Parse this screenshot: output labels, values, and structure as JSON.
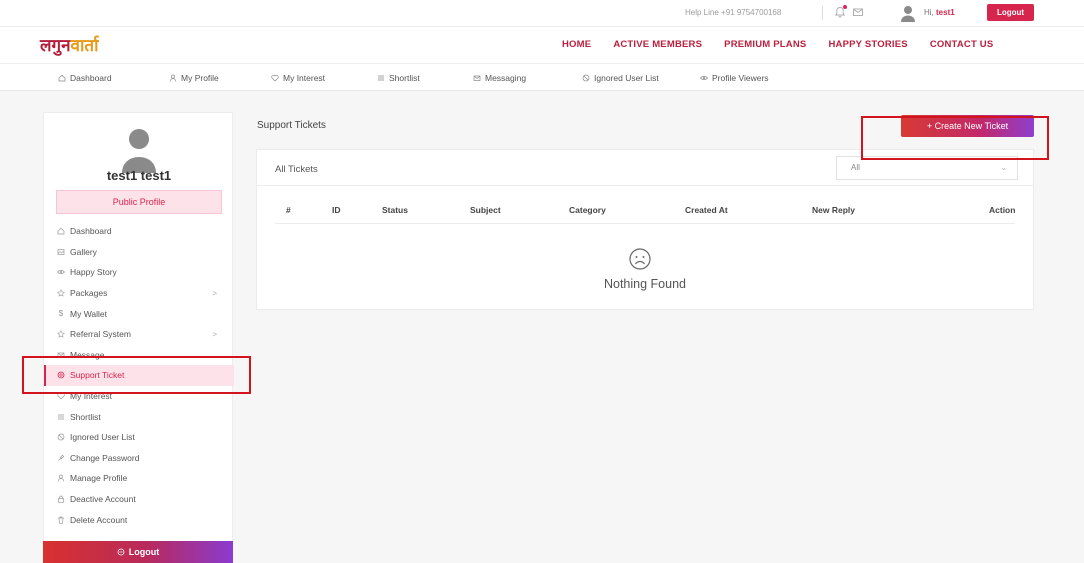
{
  "topbar": {
    "helpline": "Help Line +91 9754700168",
    "greeting_prefix": "Hi,",
    "user": "test1",
    "logout": "Logout"
  },
  "logo": {
    "part1": "लगुन",
    "part2": "वार्ता"
  },
  "mainnav": [
    "HOME",
    "ACTIVE MEMBERS",
    "PREMIUM PLANS",
    "HAPPY STORIES",
    "CONTACT US"
  ],
  "subnav": [
    {
      "label": "Dashboard",
      "icon": "home-icon"
    },
    {
      "label": "My Profile",
      "icon": "user-icon"
    },
    {
      "label": "My Interest",
      "icon": "heart-icon"
    },
    {
      "label": "Shortlist",
      "icon": "list-icon"
    },
    {
      "label": "Messaging",
      "icon": "mail-icon"
    },
    {
      "label": "Ignored User List",
      "icon": "block-icon"
    },
    {
      "label": "Profile Viewers",
      "icon": "eye-icon"
    }
  ],
  "sidebar": {
    "name": "test1 test1",
    "public_profile": "Public Profile",
    "items": [
      {
        "label": "Dashboard",
        "icon": "home-icon"
      },
      {
        "label": "Gallery",
        "icon": "image-icon"
      },
      {
        "label": "Happy Story",
        "icon": "eye-icon"
      },
      {
        "label": "Packages",
        "icon": "package-icon",
        "chevron": ">"
      },
      {
        "label": "My Wallet",
        "icon": "dollar-icon"
      },
      {
        "label": "Referral System",
        "icon": "share-icon",
        "chevron": ">"
      },
      {
        "label": "Message",
        "icon": "mail-icon"
      },
      {
        "label": "Support Ticket",
        "icon": "ticket-icon",
        "active": true
      },
      {
        "label": "My Interest",
        "icon": "heart-icon"
      },
      {
        "label": "Shortlist",
        "icon": "list-icon"
      },
      {
        "label": "Ignored User List",
        "icon": "block-icon"
      },
      {
        "label": "Change Password",
        "icon": "key-icon"
      },
      {
        "label": "Manage Profile",
        "icon": "user-icon"
      },
      {
        "label": "Deactive Account",
        "icon": "lock-icon"
      },
      {
        "label": "Delete Account",
        "icon": "trash-icon"
      }
    ],
    "logout": "Logout"
  },
  "content": {
    "title": "Support Tickets",
    "create_button": "+ Create New Ticket",
    "card_title": "All Tickets",
    "filter_value": "All",
    "columns": [
      "#",
      "ID",
      "Status",
      "Subject",
      "Category",
      "Created At",
      "New Reply",
      "Action"
    ],
    "empty_text": "Nothing Found"
  },
  "colors": {
    "brand": "#d6264e",
    "highlight": "#d4141c",
    "active_bg": "#fde2ea"
  }
}
